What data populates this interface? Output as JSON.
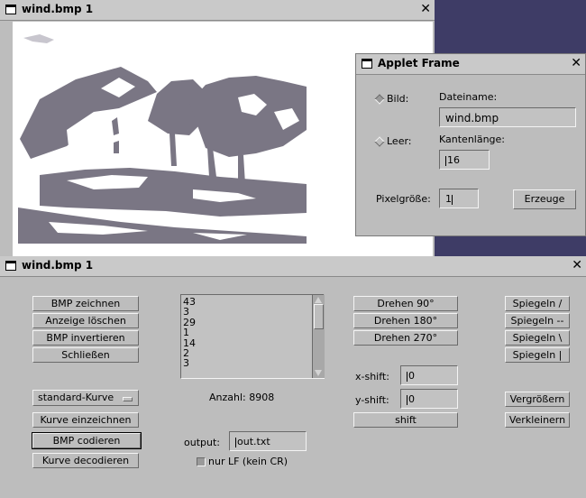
{
  "image_window": {
    "title": "wind.bmp 1",
    "close": "✕"
  },
  "applet": {
    "title": "Applet Frame",
    "close": "✕",
    "radio_bild": "Bild:",
    "radio_leer": "Leer:",
    "dateiname_label": "Dateiname:",
    "dateiname_value": "wind.bmp",
    "kantenlaenge_label": "Kantenlänge:",
    "kantenlaenge_value": "16",
    "pixelgroesse_label": "Pixelgröße:",
    "pixelgroesse_value": "1",
    "erzeuge_button": "Erzeuge"
  },
  "control_window": {
    "title": "wind.bmp 1",
    "close": "✕",
    "left_buttons": [
      "BMP zeichnen",
      "Anzeige löschen",
      "BMP invertieren",
      "Schließen"
    ],
    "curve_select": "standard-Kurve",
    "kurve_einzeichnen": "Kurve einzeichnen",
    "bmp_codieren": "BMP codieren",
    "kurve_decodieren": "Kurve decodieren",
    "list_items": [
      "43",
      "3",
      "29",
      "1",
      "14",
      "2",
      "3"
    ],
    "anzahl": "Anzahl: 8908",
    "output_label": "output:",
    "output_value": "out.txt",
    "nur_lf": "nur LF (kein CR)",
    "drehen": [
      "Drehen 90°",
      "Drehen 180°",
      "Drehen 270°"
    ],
    "xshift_label": "x-shift:",
    "xshift_value": "0",
    "yshift_label": "y-shift:",
    "yshift_value": "0",
    "shift_button": "shift",
    "spiegeln": [
      "Spiegeln /",
      "Spiegeln --",
      "Spiegeln \\",
      "Spiegeln |"
    ],
    "vergroessern": "Vergrößern",
    "verkleinern": "Verkleinern"
  },
  "colors": {
    "desktop": "#3e3c66",
    "window_bg": "#bdbdbd",
    "image_ink": "#7a7684",
    "image_paper": "#ffffff"
  }
}
